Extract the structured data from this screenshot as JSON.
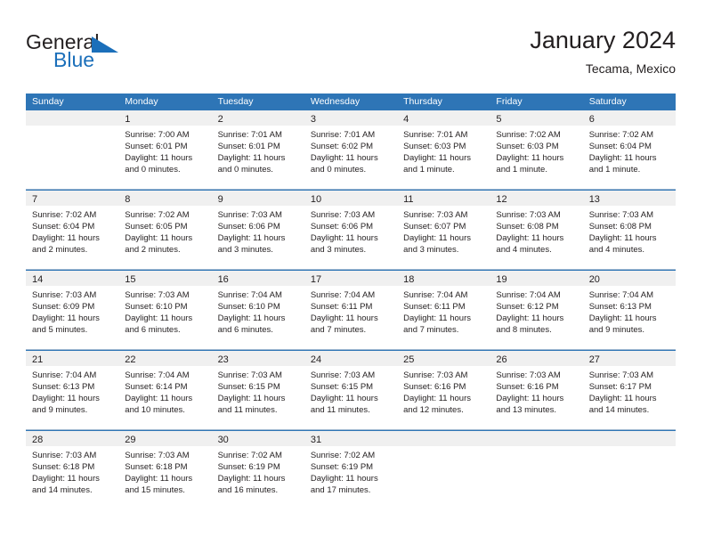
{
  "brand": {
    "name_part1": "General",
    "name_part2": "Blue",
    "logo_icon": "triangle-logo-icon"
  },
  "header": {
    "title": "January 2024",
    "subtitle": "Tecama, Mexico"
  },
  "colors": {
    "header_blue": "#2E75B6",
    "brand_blue": "#1B6FBA",
    "day_strip_gray": "#F0F0F0",
    "text": "#231F20"
  },
  "weekdays": [
    "Sunday",
    "Monday",
    "Tuesday",
    "Wednesday",
    "Thursday",
    "Friday",
    "Saturday"
  ],
  "weeks": [
    [
      {
        "day": "",
        "lines": [
          "",
          "",
          "",
          ""
        ],
        "empty": true
      },
      {
        "day": "1",
        "lines": [
          "Sunrise: 7:00 AM",
          "Sunset: 6:01 PM",
          "Daylight: 11 hours",
          "and 0 minutes."
        ]
      },
      {
        "day": "2",
        "lines": [
          "Sunrise: 7:01 AM",
          "Sunset: 6:01 PM",
          "Daylight: 11 hours",
          "and 0 minutes."
        ]
      },
      {
        "day": "3",
        "lines": [
          "Sunrise: 7:01 AM",
          "Sunset: 6:02 PM",
          "Daylight: 11 hours",
          "and 0 minutes."
        ]
      },
      {
        "day": "4",
        "lines": [
          "Sunrise: 7:01 AM",
          "Sunset: 6:03 PM",
          "Daylight: 11 hours",
          "and 1 minute."
        ]
      },
      {
        "day": "5",
        "lines": [
          "Sunrise: 7:02 AM",
          "Sunset: 6:03 PM",
          "Daylight: 11 hours",
          "and 1 minute."
        ]
      },
      {
        "day": "6",
        "lines": [
          "Sunrise: 7:02 AM",
          "Sunset: 6:04 PM",
          "Daylight: 11 hours",
          "and 1 minute."
        ]
      }
    ],
    [
      {
        "day": "7",
        "lines": [
          "Sunrise: 7:02 AM",
          "Sunset: 6:04 PM",
          "Daylight: 11 hours",
          "and 2 minutes."
        ]
      },
      {
        "day": "8",
        "lines": [
          "Sunrise: 7:02 AM",
          "Sunset: 6:05 PM",
          "Daylight: 11 hours",
          "and 2 minutes."
        ]
      },
      {
        "day": "9",
        "lines": [
          "Sunrise: 7:03 AM",
          "Sunset: 6:06 PM",
          "Daylight: 11 hours",
          "and 3 minutes."
        ]
      },
      {
        "day": "10",
        "lines": [
          "Sunrise: 7:03 AM",
          "Sunset: 6:06 PM",
          "Daylight: 11 hours",
          "and 3 minutes."
        ]
      },
      {
        "day": "11",
        "lines": [
          "Sunrise: 7:03 AM",
          "Sunset: 6:07 PM",
          "Daylight: 11 hours",
          "and 3 minutes."
        ]
      },
      {
        "day": "12",
        "lines": [
          "Sunrise: 7:03 AM",
          "Sunset: 6:08 PM",
          "Daylight: 11 hours",
          "and 4 minutes."
        ]
      },
      {
        "day": "13",
        "lines": [
          "Sunrise: 7:03 AM",
          "Sunset: 6:08 PM",
          "Daylight: 11 hours",
          "and 4 minutes."
        ]
      }
    ],
    [
      {
        "day": "14",
        "lines": [
          "Sunrise: 7:03 AM",
          "Sunset: 6:09 PM",
          "Daylight: 11 hours",
          "and 5 minutes."
        ]
      },
      {
        "day": "15",
        "lines": [
          "Sunrise: 7:03 AM",
          "Sunset: 6:10 PM",
          "Daylight: 11 hours",
          "and 6 minutes."
        ]
      },
      {
        "day": "16",
        "lines": [
          "Sunrise: 7:04 AM",
          "Sunset: 6:10 PM",
          "Daylight: 11 hours",
          "and 6 minutes."
        ]
      },
      {
        "day": "17",
        "lines": [
          "Sunrise: 7:04 AM",
          "Sunset: 6:11 PM",
          "Daylight: 11 hours",
          "and 7 minutes."
        ]
      },
      {
        "day": "18",
        "lines": [
          "Sunrise: 7:04 AM",
          "Sunset: 6:11 PM",
          "Daylight: 11 hours",
          "and 7 minutes."
        ]
      },
      {
        "day": "19",
        "lines": [
          "Sunrise: 7:04 AM",
          "Sunset: 6:12 PM",
          "Daylight: 11 hours",
          "and 8 minutes."
        ]
      },
      {
        "day": "20",
        "lines": [
          "Sunrise: 7:04 AM",
          "Sunset: 6:13 PM",
          "Daylight: 11 hours",
          "and 9 minutes."
        ]
      }
    ],
    [
      {
        "day": "21",
        "lines": [
          "Sunrise: 7:04 AM",
          "Sunset: 6:13 PM",
          "Daylight: 11 hours",
          "and 9 minutes."
        ]
      },
      {
        "day": "22",
        "lines": [
          "Sunrise: 7:04 AM",
          "Sunset: 6:14 PM",
          "Daylight: 11 hours",
          "and 10 minutes."
        ]
      },
      {
        "day": "23",
        "lines": [
          "Sunrise: 7:03 AM",
          "Sunset: 6:15 PM",
          "Daylight: 11 hours",
          "and 11 minutes."
        ]
      },
      {
        "day": "24",
        "lines": [
          "Sunrise: 7:03 AM",
          "Sunset: 6:15 PM",
          "Daylight: 11 hours",
          "and 11 minutes."
        ]
      },
      {
        "day": "25",
        "lines": [
          "Sunrise: 7:03 AM",
          "Sunset: 6:16 PM",
          "Daylight: 11 hours",
          "and 12 minutes."
        ]
      },
      {
        "day": "26",
        "lines": [
          "Sunrise: 7:03 AM",
          "Sunset: 6:16 PM",
          "Daylight: 11 hours",
          "and 13 minutes."
        ]
      },
      {
        "day": "27",
        "lines": [
          "Sunrise: 7:03 AM",
          "Sunset: 6:17 PM",
          "Daylight: 11 hours",
          "and 14 minutes."
        ]
      }
    ],
    [
      {
        "day": "28",
        "lines": [
          "Sunrise: 7:03 AM",
          "Sunset: 6:18 PM",
          "Daylight: 11 hours",
          "and 14 minutes."
        ]
      },
      {
        "day": "29",
        "lines": [
          "Sunrise: 7:03 AM",
          "Sunset: 6:18 PM",
          "Daylight: 11 hours",
          "and 15 minutes."
        ]
      },
      {
        "day": "30",
        "lines": [
          "Sunrise: 7:02 AM",
          "Sunset: 6:19 PM",
          "Daylight: 11 hours",
          "and 16 minutes."
        ]
      },
      {
        "day": "31",
        "lines": [
          "Sunrise: 7:02 AM",
          "Sunset: 6:19 PM",
          "Daylight: 11 hours",
          "and 17 minutes."
        ]
      },
      {
        "day": "",
        "lines": [
          "",
          "",
          "",
          ""
        ],
        "empty": true
      },
      {
        "day": "",
        "lines": [
          "",
          "",
          "",
          ""
        ],
        "empty": true
      },
      {
        "day": "",
        "lines": [
          "",
          "",
          "",
          ""
        ],
        "empty": true
      }
    ]
  ]
}
